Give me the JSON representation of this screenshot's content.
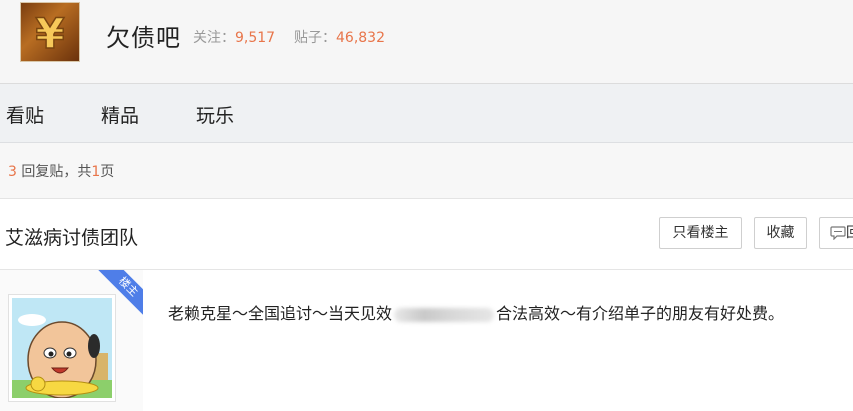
{
  "forum": {
    "name": "欠债吧",
    "follow_label": "关注：",
    "follow_count": "9,517",
    "posts_label": "贴子：",
    "posts_count": "46,832",
    "logo_glyph": "¥"
  },
  "nav": {
    "tabs": [
      {
        "label": "看贴"
      },
      {
        "label": "精品"
      },
      {
        "label": "玩乐"
      }
    ]
  },
  "pager": {
    "reply_count": "3",
    "reply_label": " 回复贴，共",
    "page_count": "1",
    "page_label": "页"
  },
  "thread": {
    "title": "艾滋病讨债团队",
    "buttons": {
      "only_op": "只看楼主",
      "favorite": "收藏",
      "reply": "回"
    }
  },
  "post": {
    "op_badge": "楼主",
    "content_before": "老赖克星～全国追讨～当天见效",
    "content_after": "合法高效～有介绍单子的朋友有好处费。"
  },
  "colors": {
    "accent_orange": "#e8754a",
    "badge_blue": "#4f7ee8",
    "nav_bg": "#eff1f3"
  },
  "icons": {
    "logo": "yuan-logo-icon",
    "reply": "comment-icon",
    "avatar": "cartoon-avatar"
  }
}
